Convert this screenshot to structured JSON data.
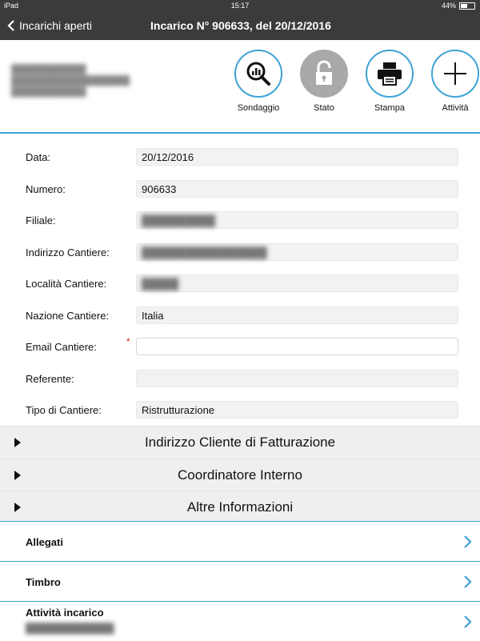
{
  "status_bar": {
    "carrier": "iPad",
    "time": "15:17",
    "battery": "44%",
    "battery_level": 0.44
  },
  "navbar": {
    "back_label": "Incarichi aperti",
    "title": "Incarico N° 906633, del 20/12/2016"
  },
  "header": {
    "blurred_lines": [
      "████████████",
      "███████████████████",
      "████████████"
    ],
    "actions": [
      {
        "label": "Sondaggio",
        "icon": "search-chart-icon"
      },
      {
        "label": "Stato",
        "icon": "unlock-icon"
      },
      {
        "label": "Stampa",
        "icon": "printer-icon"
      },
      {
        "label": "Attività",
        "icon": "plus-icon"
      }
    ]
  },
  "form": {
    "rows": [
      {
        "label": "Data:",
        "value": "20/12/2016"
      },
      {
        "label": "Numero:",
        "value": "906633"
      },
      {
        "label": "Filiale:",
        "value": "██████████"
      },
      {
        "label": "Indirizzo Cantiere:",
        "value": "█████████████████"
      },
      {
        "label": "Località Cantiere:",
        "value": "█████"
      },
      {
        "label": "Nazione Cantiere:",
        "value": "Italia"
      },
      {
        "label": "Email Cantiere:",
        "value": "",
        "required_mark": "*"
      },
      {
        "label": "Referente:",
        "value": ""
      },
      {
        "label": "Tipo di Cantiere:",
        "value": "Ristrutturazione"
      }
    ]
  },
  "sections": [
    {
      "title": "Indirizzo Cliente di Fatturazione"
    },
    {
      "title": "Coordinatore Interno"
    },
    {
      "title": "Altre Informazioni"
    }
  ],
  "list": [
    {
      "title": "Allegati"
    },
    {
      "title": "Timbro"
    },
    {
      "title": "Attività incarico",
      "subtitle": "█████████████"
    }
  ],
  "colors": {
    "accent": "#3fa3d6",
    "navbar": "#3b3b3b",
    "required": "#dd2222"
  }
}
